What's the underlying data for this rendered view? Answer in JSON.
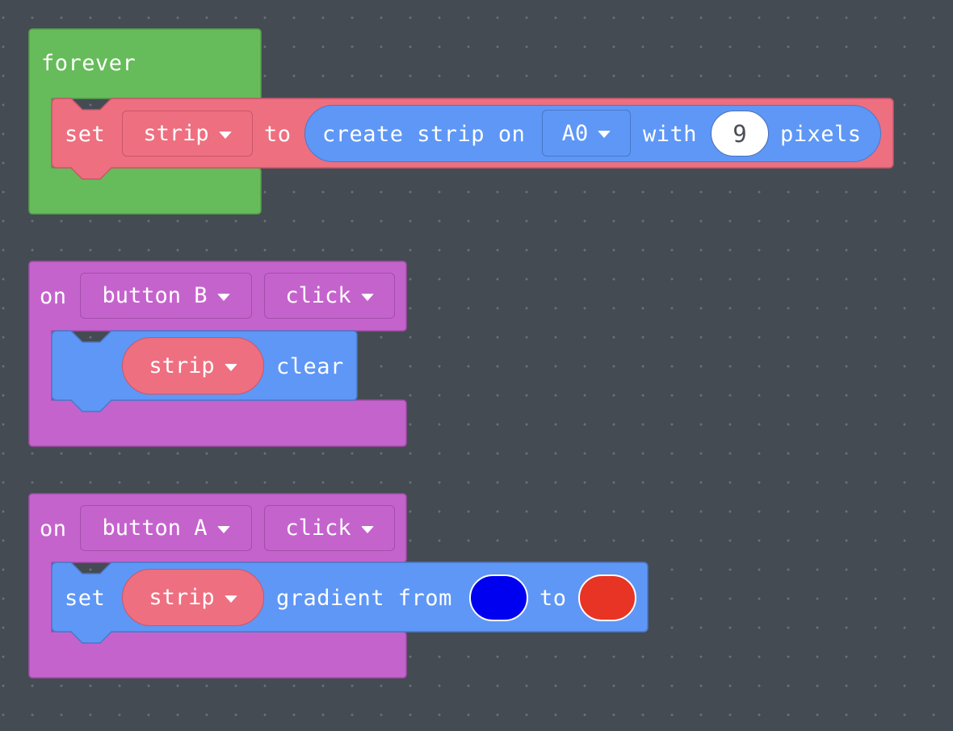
{
  "colors": {
    "workspace_bg": "#454b53",
    "loops_green": "#66bb5a",
    "variables_pink": "#ee6f80",
    "light_blue": "#5e97f6",
    "input_purple": "#c563cd"
  },
  "blocks": {
    "forever": {
      "label": "forever",
      "set_statement": {
        "set_label": "set",
        "variable": "strip",
        "to_label": "to",
        "reporter": {
          "create_label": "create strip on",
          "pin": "A0",
          "with_label": "with",
          "pixel_count": "9",
          "pixels_label": "pixels"
        }
      }
    },
    "on_button_b": {
      "on_label": "on",
      "button": "button B",
      "event": "click",
      "statement": {
        "variable": "strip",
        "action_label": "clear"
      }
    },
    "on_button_a": {
      "on_label": "on",
      "button": "button A",
      "event": "click",
      "statement": {
        "set_label": "set",
        "variable": "strip",
        "gradient_label": "gradient from",
        "from_color": "#0000f0",
        "to_label": "to",
        "to_color": "#e83424"
      }
    }
  }
}
